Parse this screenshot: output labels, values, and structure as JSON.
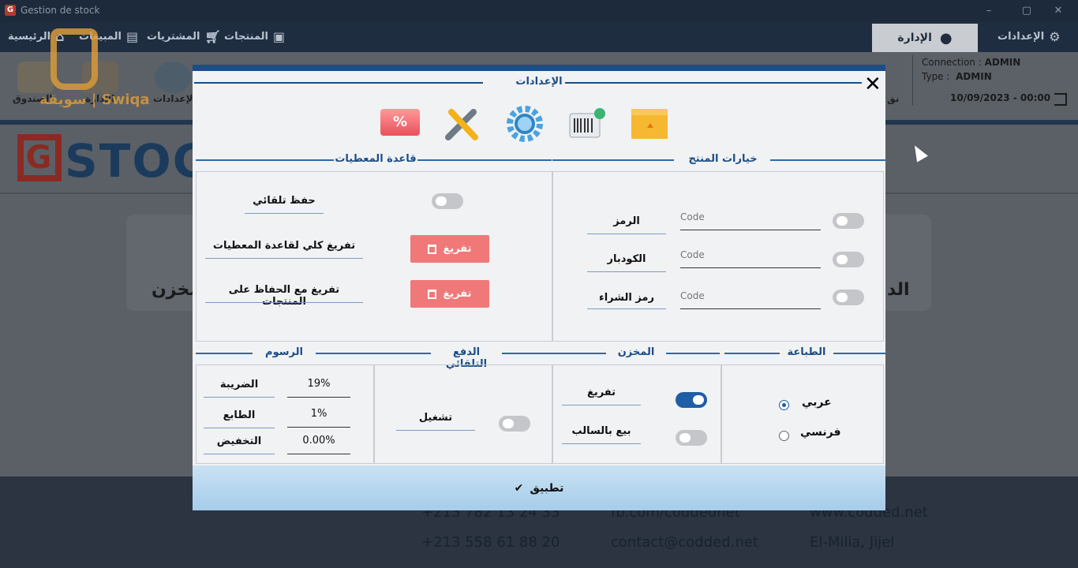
{
  "titlebar": {
    "app_icon": "G",
    "title": "Gestion de stock",
    "minimize": "–",
    "maximize": "▢",
    "close": "✕"
  },
  "menubar": {
    "items": [
      {
        "label": "الرئيسية",
        "icon": "home-icon"
      },
      {
        "label": "المبيعات",
        "icon": "sales-icon"
      },
      {
        "label": "المشتريات",
        "icon": "cart-icon"
      },
      {
        "label": "المنتجات",
        "icon": "box-icon"
      }
    ],
    "admin_tab": "الإدارة",
    "settings": "الإعدادات"
  },
  "ribbon": {
    "items": [
      "الصندوق",
      "الإدارة",
      "الإعدادات"
    ],
    "partial_label": "نق"
  },
  "connection": {
    "line1_label": "Connection :",
    "line1_value": "ADMIN",
    "line2_label": "Type :",
    "line2_value": "ADMIN",
    "datetime": "10/09/2023 - 00:00"
  },
  "background": {
    "logo_letter": "G",
    "logo_text": "STOC",
    "card_left_label": "المخزن",
    "card_right_label": "الد",
    "watermark": "سويقة | Swiqa"
  },
  "footer": {
    "brand": "codded",
    "phone1": "+213 782 13 24 33",
    "phone2": "+213 558 61 88 20",
    "facebook": "fb.com/coddednet",
    "email": "contact@codded.net",
    "website": "www.codded.net",
    "address": "El-Milia, Jijel"
  },
  "modal": {
    "title": "الإعدادات",
    "close": "✕",
    "toolbar_icons": [
      "discount-icon",
      "tools-icon",
      "gear-icon",
      "barcode-icon",
      "package-icon"
    ],
    "discount_text": "%",
    "product_options": {
      "title": "خيارات المنتج",
      "rows": [
        {
          "label": "الرمز",
          "placeholder": "Code",
          "enabled": false
        },
        {
          "label": "الكودبار",
          "placeholder": "Code",
          "enabled": false
        },
        {
          "label": "رمز الشراء",
          "placeholder": "Code",
          "enabled": false
        }
      ]
    },
    "database": {
      "title": "قاعدة المعطيات",
      "auto_save_label": "حفظ تلقائي",
      "auto_save_enabled": false,
      "clear_all_label": "تفريغ كلي لقاعدة المعطيات",
      "clear_keep_label": "تفريغ مع الحفاظ على المنتجات",
      "clear_button": "تفريغ"
    },
    "printing": {
      "title": "الطباعة",
      "options": [
        {
          "label": "عربي",
          "checked": true
        },
        {
          "label": "فرنسي",
          "checked": false
        }
      ]
    },
    "store": {
      "title": "المخزن",
      "rows": [
        {
          "label": "تفريغ",
          "enabled": true
        },
        {
          "label": "بيع بالسالب",
          "enabled": false
        }
      ]
    },
    "auto_pay": {
      "title": "الدفع التلقائي",
      "label": "تشغيل",
      "enabled": false
    },
    "fees": {
      "title": "الرسوم",
      "rows": [
        {
          "label": "الضريبة",
          "value": "19%"
        },
        {
          "label": "الطابع",
          "value": "1%"
        },
        {
          "label": "التخفيض",
          "value": "0.00%"
        }
      ]
    },
    "apply": "تطبيق"
  },
  "colors": {
    "accent": "#1b4d86",
    "danger": "#f07878",
    "toggle_on": "#1f5ea4",
    "apply_bar": "#a6cdea"
  }
}
